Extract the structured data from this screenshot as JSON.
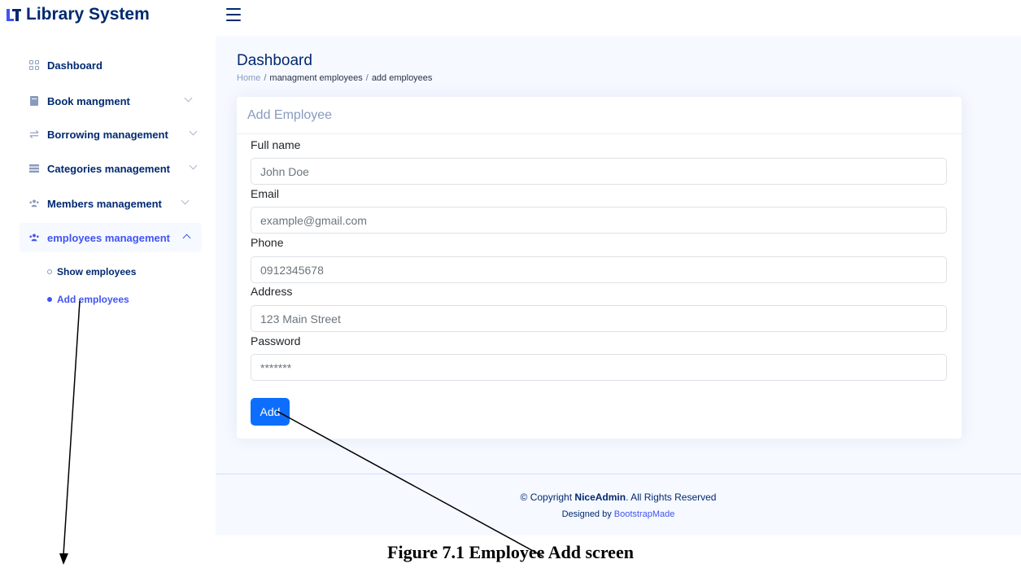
{
  "header": {
    "logo_text": "Library System",
    "menu_icon": "hamburger-icon"
  },
  "sidebar": {
    "items": [
      {
        "label": "Dashboard",
        "icon": "grid-icon"
      },
      {
        "label": "Book mangment",
        "icon": "book-icon"
      },
      {
        "label": "Borrowing management",
        "icon": "arrows-exchange-icon"
      },
      {
        "label": "Categories management",
        "icon": "list-icon"
      },
      {
        "label": "Members management",
        "icon": "people-icon"
      },
      {
        "label": "employees management",
        "icon": "people-icon"
      }
    ],
    "subitems": [
      {
        "label": "Show employees"
      },
      {
        "label": "Add employees"
      }
    ]
  },
  "main": {
    "page_title": "Dashboard",
    "breadcrumb": {
      "home": "Home",
      "sep": "/",
      "middle": "managment employees",
      "current": "add employees"
    },
    "card": {
      "title": "Add Employee",
      "fields": {
        "full_name": {
          "label": "Full name",
          "placeholder": "John Doe"
        },
        "email": {
          "label": "Email",
          "placeholder": "example@gmail.com"
        },
        "phone": {
          "label": "Phone",
          "placeholder": "0912345678"
        },
        "address": {
          "label": "Address",
          "placeholder": "123 Main Street"
        },
        "password": {
          "label": "Password",
          "placeholder": "*******"
        }
      },
      "submit_label": "Add"
    }
  },
  "footer": {
    "copyright_prefix": "© Copyright",
    "brand": "NiceAdmin",
    "copyright_suffix": ". All Rights Reserved",
    "designed_prefix": "Designed by",
    "designed_link": "BootstrapMade"
  },
  "caption": "Figure 7.1 Employee Add screen",
  "colors": {
    "brand": "#012970",
    "accent": "#4154f1",
    "button": "#0d6efd",
    "background": "#f6f9ff"
  }
}
